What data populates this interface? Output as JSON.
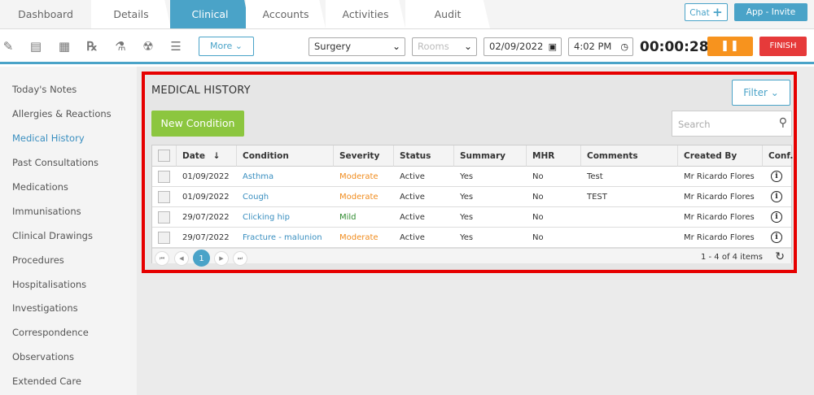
{
  "tabs": [
    {
      "label": "Dashboard"
    },
    {
      "label": "Details"
    },
    {
      "label": "Clinical"
    },
    {
      "label": "Accounts"
    },
    {
      "label": "Activities"
    },
    {
      "label": "Audit"
    }
  ],
  "header": {
    "chat_label": "Chat",
    "invite_label": "App - Invite"
  },
  "toolbar": {
    "more_label": "More",
    "location_value": "Surgery",
    "rooms_placeholder": "Rooms",
    "date_value": "02/09/2022",
    "time_value": "4:02 PM",
    "timer": "00:00:28",
    "finish_label": "FINISH",
    "icons": [
      "notes-icon",
      "document-icon",
      "form-icon",
      "rx-icon",
      "lab-icon",
      "radiation-icon",
      "stack-icon"
    ]
  },
  "sidebar": {
    "items": [
      {
        "label": "Today's Notes"
      },
      {
        "label": "Allergies & Reactions"
      },
      {
        "label": "Medical History"
      },
      {
        "label": "Past Consultations"
      },
      {
        "label": "Medications"
      },
      {
        "label": "Immunisations"
      },
      {
        "label": "Clinical Drawings"
      },
      {
        "label": "Procedures"
      },
      {
        "label": "Hospitalisations"
      },
      {
        "label": "Investigations"
      },
      {
        "label": "Correspondence"
      },
      {
        "label": "Observations"
      },
      {
        "label": "Extended Care"
      }
    ]
  },
  "panel": {
    "title": "MEDICAL HISTORY",
    "filter_label": "Filter",
    "new_button": "New Condition",
    "search_placeholder": "Search"
  },
  "table": {
    "columns": [
      "Date",
      "Condition",
      "Severity",
      "Status",
      "Summary",
      "MHR",
      "Comments",
      "Created By",
      "Conf."
    ],
    "rows": [
      {
        "date": "01/09/2022",
        "condition": "Asthma",
        "severity": "Moderate",
        "status": "Active",
        "summary": "Yes",
        "mhr": "No",
        "comments": "Test",
        "created_by": "Mr Ricardo Flores"
      },
      {
        "date": "01/09/2022",
        "condition": "Cough",
        "severity": "Moderate",
        "status": "Active",
        "summary": "Yes",
        "mhr": "No",
        "comments": "TEST",
        "created_by": "Mr Ricardo Flores"
      },
      {
        "date": "29/07/2022",
        "condition": "Clicking hip",
        "severity": "Mild",
        "status": "Active",
        "summary": "Yes",
        "mhr": "No",
        "comments": "",
        "created_by": "Mr Ricardo Flores"
      },
      {
        "date": "29/07/2022",
        "condition": "Fracture - malunion",
        "severity": "Moderate",
        "status": "Active",
        "summary": "Yes",
        "mhr": "No",
        "comments": "",
        "created_by": "Mr Ricardo Flores"
      }
    ],
    "current_page": "1",
    "items_summary": "1 - 4 of 4 items"
  },
  "colors": {
    "accent": "#4aa3c8",
    "new_button": "#8cc63f",
    "pause": "#f7931e",
    "finish": "#e63a3a",
    "highlight_border": "#e60000",
    "moderate": "#f08c1e",
    "mild": "#2e8b2e"
  }
}
